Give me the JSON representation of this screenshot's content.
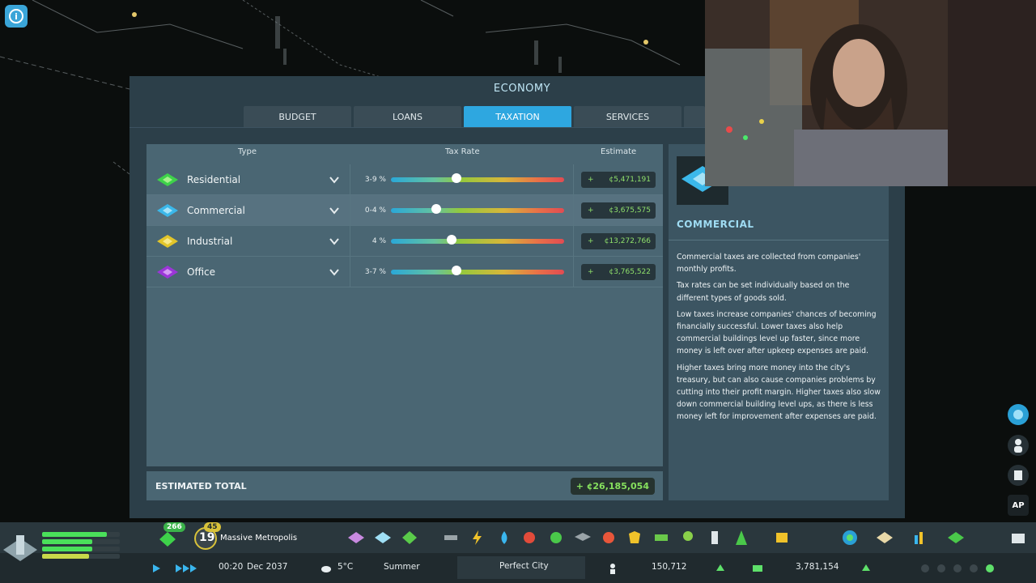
{
  "panel": {
    "title": "ECONOMY",
    "tabs": [
      {
        "label": "BUDGET",
        "active": false
      },
      {
        "label": "LOANS",
        "active": false
      },
      {
        "label": "TAXATION",
        "active": true
      },
      {
        "label": "SERVICES",
        "active": false
      }
    ]
  },
  "table": {
    "headers": {
      "type": "Type",
      "rate": "Tax Rate",
      "estimate": "Estimate"
    },
    "rows": [
      {
        "label": "Residential",
        "rate": "3-9 %",
        "slider_fraction": 0.38,
        "sign": "+",
        "estimate": "¢5,471,191",
        "icon_color": "#3ed24a"
      },
      {
        "label": "Commercial",
        "rate": "0-4 %",
        "slider_fraction": 0.26,
        "sign": "+",
        "estimate": "¢3,675,575",
        "icon_color": "#3bb8ea"
      },
      {
        "label": "Industrial",
        "rate": "4 %",
        "slider_fraction": 0.35,
        "sign": "+",
        "estimate": "¢13,272,766",
        "icon_color": "#e2c52a"
      },
      {
        "label": "Office",
        "rate": "3-7 %",
        "slider_fraction": 0.38,
        "sign": "+",
        "estimate": "¢3,765,522",
        "icon_color": "#9b36d8"
      }
    ],
    "total_label": "ESTIMATED TOTAL",
    "total_value": "+ ¢26,185,054"
  },
  "info": {
    "title": "COMMERCIAL",
    "paragraphs": [
      "Commercial taxes are collected from companies' monthly profits.",
      "Tax rates can be set individually based on the different types of goods sold.",
      "Low taxes increase companies' chances of becoming financially successful. Lower taxes also help commercial buildings level up faster, since more money is left over after upkeep expenses are paid.",
      "Higher taxes bring more money into the city's treasury, but can also cause companies problems by cutting into their profit margin. Higher taxes also slow down commercial building level ups, as there is less money left for improvement after expenses are paid."
    ]
  },
  "side": {
    "ap_label": "AP"
  },
  "bottom": {
    "xp_badge": "266",
    "level": "19",
    "level_badge": "45",
    "city_name": "Massive Metropolis",
    "time": "00:20",
    "date": "Dec 2037",
    "temperature": "5°C",
    "season": "Summer",
    "milestone": "Perfect City",
    "population": "150,712",
    "money": "3,781,154"
  },
  "colors": {
    "accent": "#2ea7e0",
    "positive": "#86e15e"
  }
}
